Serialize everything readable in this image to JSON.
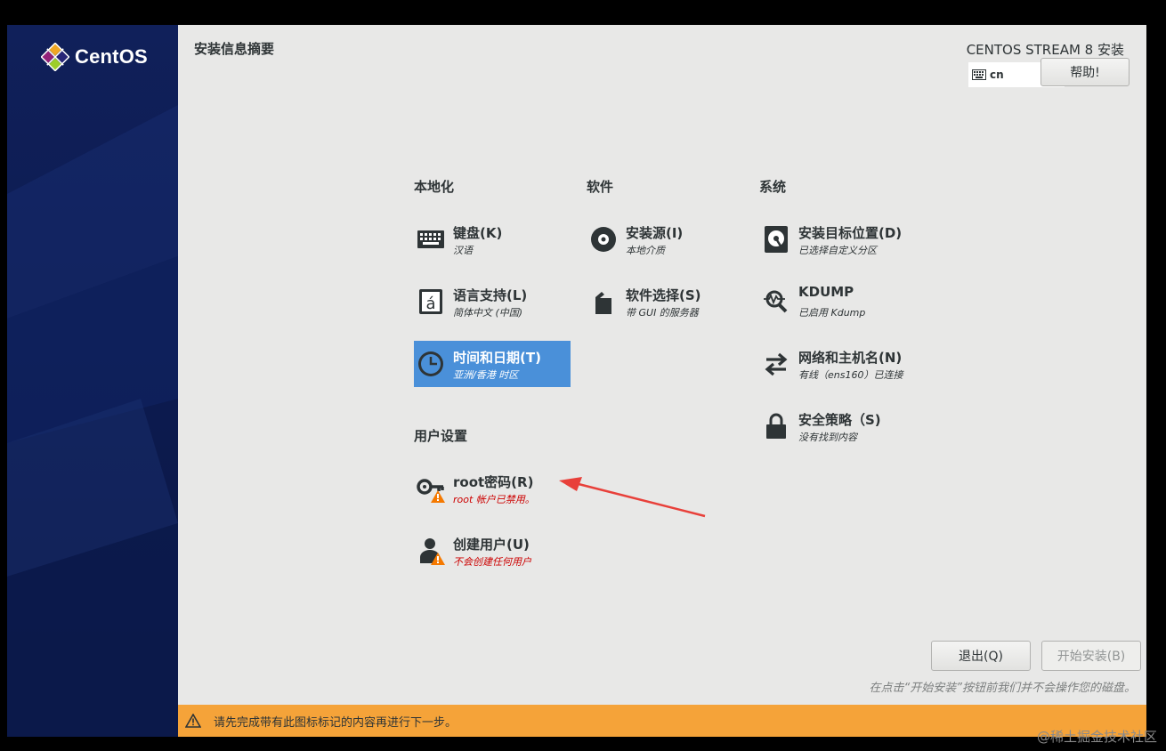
{
  "brand": {
    "logo_text": "CentOS"
  },
  "header": {
    "page_title": "安装信息摘要",
    "product_title": "CENTOS STREAM 8 安装",
    "keyboard_layout": "cn",
    "help_label": "帮助!"
  },
  "categories": {
    "localization": {
      "title": "本地化",
      "spokes": [
        {
          "title": "键盘(K)",
          "status": "汉语",
          "icon": "keyboard-icon"
        },
        {
          "title": "语言支持(L)",
          "status": "简体中文 (中国)",
          "icon": "language-icon"
        },
        {
          "title": "时间和日期(T)",
          "status": "亚洲/香港 时区",
          "icon": "clock-icon",
          "selected": true
        }
      ]
    },
    "software": {
      "title": "软件",
      "spokes": [
        {
          "title": "安装源(I)",
          "status": "本地介质",
          "icon": "disc-icon"
        },
        {
          "title": "软件选择(S)",
          "status": "带 GUI 的服务器",
          "icon": "package-icon"
        }
      ]
    },
    "system": {
      "title": "系统",
      "spokes": [
        {
          "title": "安装目标位置(D)",
          "status": "已选择自定义分区",
          "icon": "harddisk-icon"
        },
        {
          "title": "KDUMP",
          "status": "已启用 Kdump",
          "icon": "kdump-icon"
        },
        {
          "title": "网络和主机名(N)",
          "status": "有线（ens160）已连接",
          "icon": "network-icon"
        },
        {
          "title": "安全策略（S)",
          "status": "没有找到内容",
          "icon": "lock-icon"
        }
      ]
    },
    "user_settings": {
      "title": "用户设置",
      "spokes": [
        {
          "title": "root密码(R)",
          "status": "root 帐户已禁用。",
          "icon": "key-icon",
          "warning": true
        },
        {
          "title": "创建用户(U)",
          "status": "不会创建任何用户",
          "icon": "user-icon",
          "warning": true
        }
      ]
    }
  },
  "footer": {
    "quit_label": "退出(Q)",
    "begin_label": "开始安装(B)",
    "hint": "在点击“开始安装”按钮前我们并不会操作您的磁盘。",
    "warning_text": "请先完成带有此图标标记的内容再进行下一步。"
  },
  "watermark": "@稀土掘金技术社区",
  "colors": {
    "sidebar": "#10205a",
    "selected_spoke": "#4a90d9",
    "warning_bar": "#f5a339",
    "warning_text": "#cc0000",
    "annotation_arrow": "#e8403a"
  }
}
